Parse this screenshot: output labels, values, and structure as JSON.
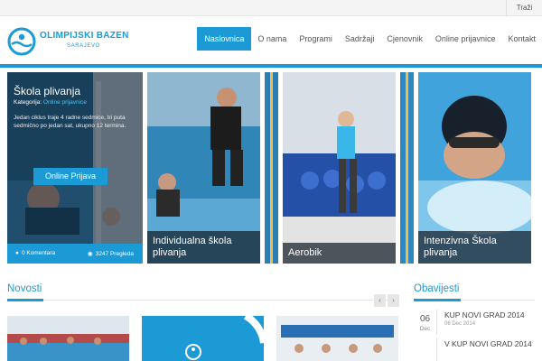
{
  "topbar": {
    "search_label": "Traži"
  },
  "logo": {
    "title": "OLIMPIJSKI BAZEN",
    "subtitle": "SARAJEVO"
  },
  "nav": {
    "items": [
      "Naslovnica",
      "O nama",
      "Programi",
      "Sadržaji",
      "Cjenovnik",
      "Online prijavnice",
      "Kontakt"
    ],
    "active_index": 0
  },
  "hero": {
    "featured": {
      "title": "Škola plivanja",
      "category_label": "Kategorija:",
      "category_value": "Online prijavnice",
      "description": "Jedan ciklus traje 4 radne sedmice, tri puta sedmično po jedan sat, ukupno 12 termina.",
      "button_label": "Online Prijava",
      "comments": "0 Komentara",
      "views": "3247 Pregleda"
    },
    "panels": [
      {
        "caption": "Individualna škola plivanja"
      },
      {
        "caption": "Aerobik"
      },
      {
        "caption": "Intenzivna Škola plivanja"
      }
    ]
  },
  "news": {
    "heading": "Novosti",
    "prev_label": "‹",
    "next_label": "›"
  },
  "notices": {
    "heading": "Obavijesti",
    "items": [
      {
        "day": "06",
        "month": "Dec",
        "title": "KUP NOVI GRAD 2014",
        "date": "06 Dec 2014"
      },
      {
        "day": "",
        "month": "",
        "title": "V KUP NOVI GRAD 2014",
        "date": ""
      }
    ]
  },
  "colors": {
    "accent": "#1b9ad6"
  }
}
